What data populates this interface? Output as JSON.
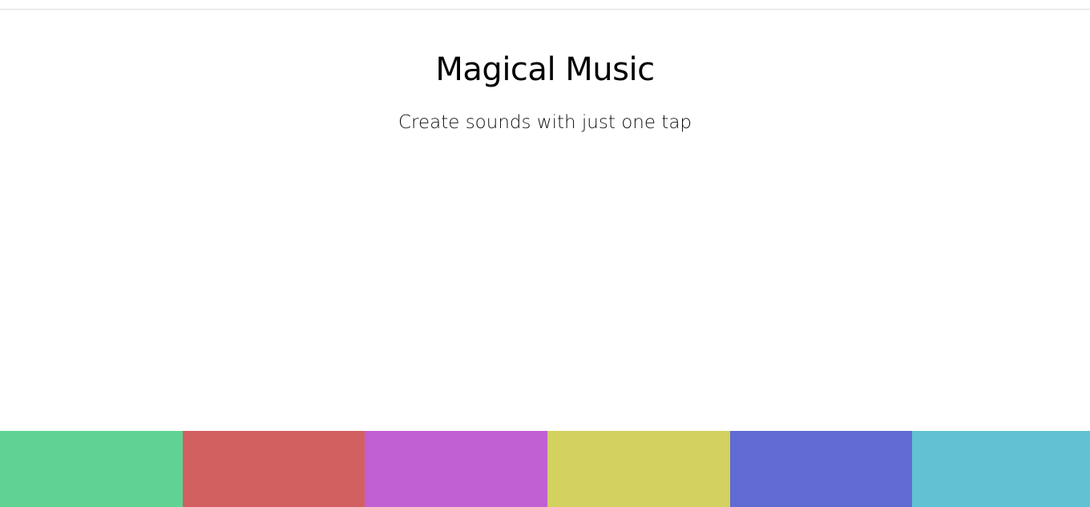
{
  "header": {
    "title": "Magical Music",
    "subtitle": "Create sounds with just one tap"
  },
  "pads": [
    {
      "name": "pad-1",
      "color": "#60d394"
    },
    {
      "name": "pad-2",
      "color": "#d36060"
    },
    {
      "name": "pad-3",
      "color": "#c060d3"
    },
    {
      "name": "pad-4",
      "color": "#d3d160"
    },
    {
      "name": "pad-5",
      "color": "#606bd3"
    },
    {
      "name": "pad-6",
      "color": "#60c2d3"
    }
  ]
}
